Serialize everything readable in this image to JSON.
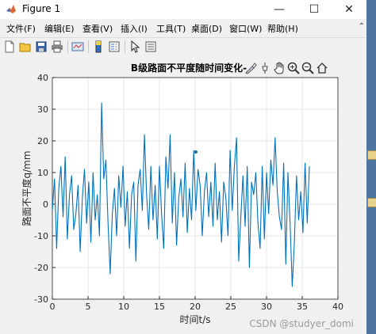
{
  "window": {
    "title": "Figure 1",
    "minimize": "—",
    "maximize": "☐",
    "close": "✕"
  },
  "menus": [
    "文件(F)",
    "编辑(E)",
    "查看(V)",
    "插入(I)",
    "工具(T)",
    "桌面(D)",
    "窗口(W)",
    "帮助(H)"
  ],
  "toolbar_icons": [
    "new-figure-icon",
    "open-file-icon",
    "save-icon",
    "print-icon",
    "link-plot-icon",
    "insert-colorbar-icon",
    "insert-legend-icon",
    "select-pointer-icon",
    "property-editor-icon"
  ],
  "axes_toolbar_icons": [
    "brush-icon",
    "data-tips-icon",
    "pan-icon",
    "zoom-in-icon",
    "zoom-out-icon",
    "home-icon"
  ],
  "watermark": "CSDN @studyer_domi",
  "colors": {
    "line": "#0072BD",
    "grid": "#e6e6e6",
    "axes_bg": "#ffffff",
    "figure_bg": "#f0f0f0"
  },
  "chart_data": {
    "type": "line",
    "title": "B级路面不平度随时间变化-",
    "xlabel": "时间t/s",
    "ylabel": "路面不平度q/mm",
    "xlim": [
      0,
      40
    ],
    "ylim": [
      -30,
      40
    ],
    "xticks": [
      0,
      5,
      10,
      15,
      20,
      25,
      30,
      35,
      40
    ],
    "yticks": [
      -30,
      -20,
      -10,
      0,
      10,
      20,
      30,
      40
    ],
    "grid": true,
    "series": [
      {
        "color": "#0072BD",
        "x": [
          0,
          0.3,
          0.6,
          0.9,
          1.2,
          1.5,
          1.8,
          2.1,
          2.4,
          2.7,
          3.0,
          3.3,
          3.6,
          3.9,
          4.2,
          4.5,
          4.8,
          5.1,
          5.4,
          5.7,
          6.0,
          6.3,
          6.6,
          6.9,
          7.2,
          7.5,
          7.8,
          8.1,
          8.4,
          8.7,
          9.0,
          9.3,
          9.6,
          9.9,
          10.2,
          10.5,
          10.8,
          11.1,
          11.4,
          11.7,
          12.0,
          12.3,
          12.6,
          12.9,
          13.2,
          13.5,
          13.8,
          14.1,
          14.4,
          14.7,
          15.0,
          15.3,
          15.6,
          15.9,
          16.2,
          16.5,
          16.8,
          17.1,
          17.4,
          17.7,
          18.0,
          18.3,
          18.6,
          18.9,
          19.2,
          19.5,
          19.8,
          20.1,
          20.4,
          20.7,
          21.0,
          21.3,
          21.6,
          21.9,
          22.2,
          22.5,
          22.8,
          23.1,
          23.4,
          23.7,
          24.0,
          24.3,
          24.6,
          24.9,
          25.2,
          25.5,
          25.8,
          26.1,
          26.4,
          26.7,
          27.0,
          27.3,
          27.6,
          27.9,
          28.2,
          28.5,
          28.8,
          29.1,
          29.4,
          29.7,
          30.0,
          30.3,
          30.6,
          30.9,
          31.2,
          31.5,
          31.8,
          32.1,
          32.4,
          32.7,
          33.0,
          33.3,
          33.6,
          33.9,
          34.2,
          34.5,
          34.8,
          35.1,
          35.4,
          35.7,
          36.0
        ],
        "y": [
          -2,
          8,
          -14,
          5,
          12,
          -4,
          15,
          -11,
          3,
          9,
          -8,
          -3,
          6,
          -15,
          2,
          11,
          -6,
          7,
          -12,
          10,
          -5,
          3,
          -10,
          32,
          8,
          14,
          -6,
          -22,
          -3,
          5,
          -10,
          9,
          -1,
          12,
          -7,
          4,
          -14,
          3,
          7,
          -18,
          6,
          11,
          -2,
          22,
          3,
          -8,
          12,
          -5,
          6,
          -11,
          12,
          -3,
          -14,
          15,
          5,
          22,
          -6,
          10,
          -13,
          2,
          8,
          -4,
          13,
          -9,
          5,
          -5,
          17,
          -2,
          11,
          6,
          -10,
          4,
          10,
          -4,
          7,
          -7,
          13,
          -5,
          4,
          -12,
          7,
          2,
          -10,
          17,
          -2,
          12,
          21,
          -18,
          -4,
          9,
          -7,
          12,
          -20,
          7,
          3,
          10,
          -6,
          -14,
          12,
          -11,
          10,
          -3,
          14,
          6,
          21,
          4,
          -4,
          -8,
          13,
          -19,
          10,
          -6,
          -26,
          -12,
          9,
          -5,
          4,
          -9,
          13,
          -6,
          12
        ]
      }
    ],
    "annotations": [
      {
        "x": 20.1,
        "y": 16.5,
        "marker": "dot"
      }
    ]
  }
}
